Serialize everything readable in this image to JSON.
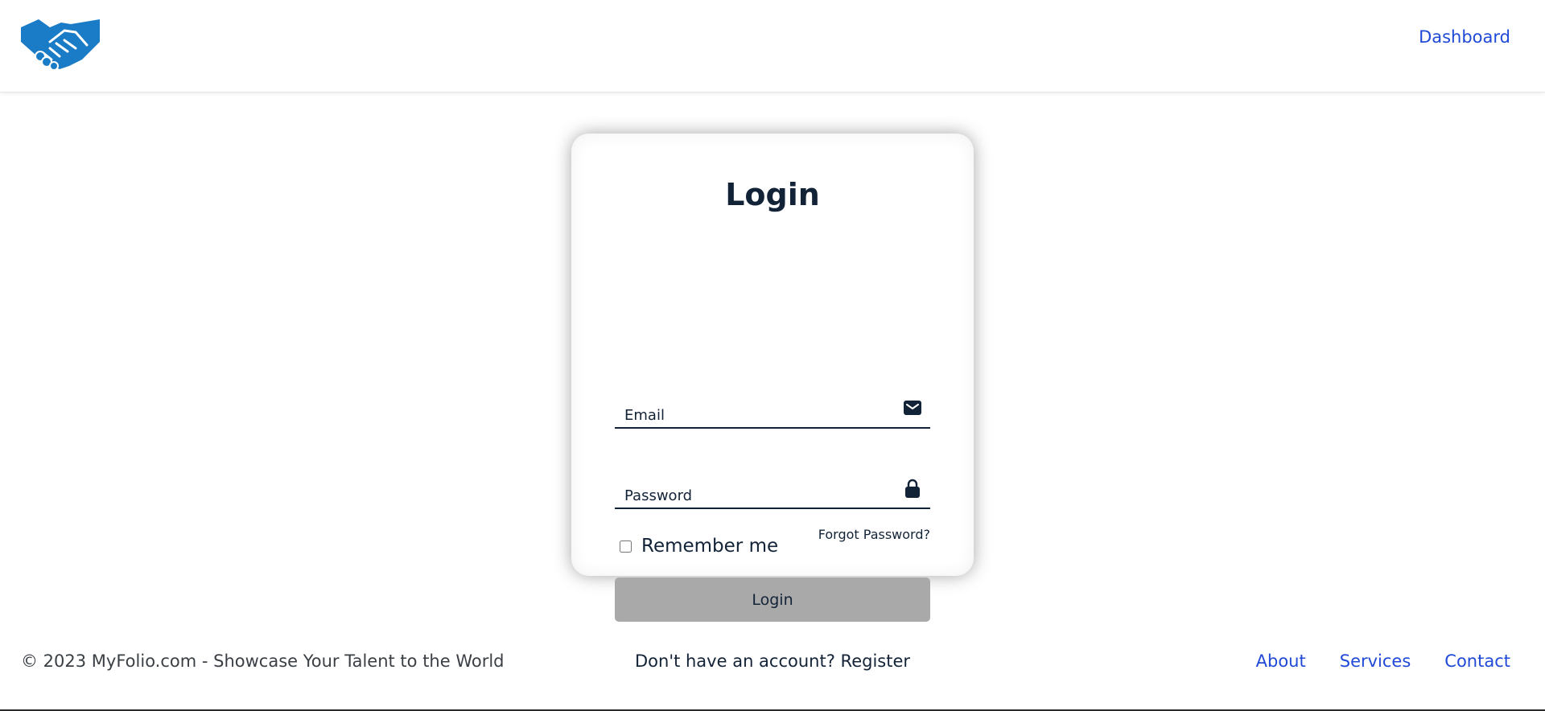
{
  "header": {
    "logo_icon": "handshake-icon",
    "nav": {
      "dashboard_label": "Dashboard"
    }
  },
  "login_card": {
    "title": "Login",
    "email": {
      "value": "",
      "placeholder": "Email",
      "icon": "envelope-icon"
    },
    "password": {
      "value": "",
      "placeholder": "Password",
      "icon": "lock-icon"
    },
    "remember_label": "Remember me",
    "remember_checked": false,
    "forgot_label": "Forgot Password?",
    "submit_label": "Login",
    "register_prompt": "Don't have an account?",
    "register_label": "Register"
  },
  "footer": {
    "copyright": "© 2023 MyFolio.com - Showcase Your Talent to the World",
    "links": [
      "About",
      "Services",
      "Contact"
    ]
  },
  "colors": {
    "brand_blue": "#1a7bc6",
    "link_blue": "#1f49d6",
    "text_dark": "#132337",
    "button_gray": "#a9a9a9"
  }
}
